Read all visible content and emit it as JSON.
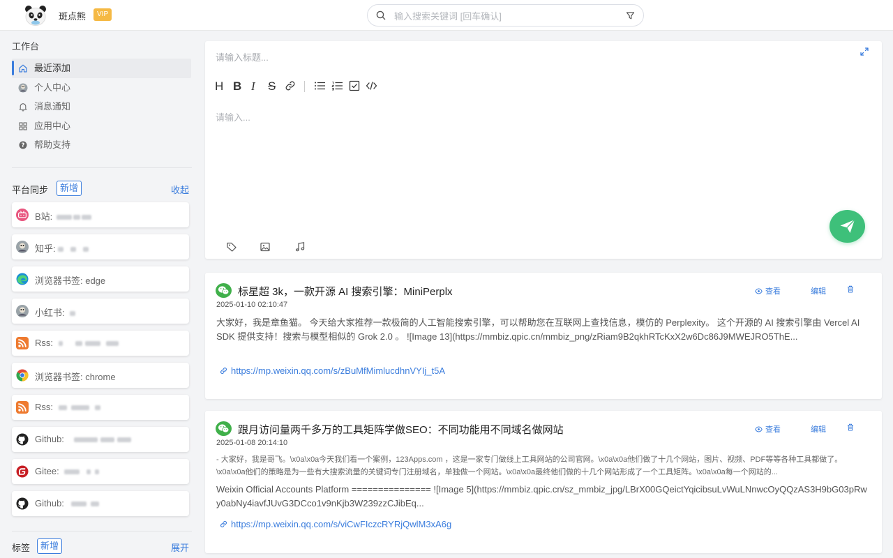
{
  "header": {
    "app_name": "斑点熊",
    "vip_badge": "VIP",
    "search_placeholder": "输入搜索关键词 [回车确认]"
  },
  "sidebar": {
    "workspace_title": "工作台",
    "nav": [
      {
        "label": "最近添加",
        "icon": "home-icon",
        "active": true
      },
      {
        "label": "个人中心",
        "icon": "avatar-icon"
      },
      {
        "label": "消息通知",
        "icon": "bell-icon"
      },
      {
        "label": "应用中心",
        "icon": "grid-icon"
      },
      {
        "label": "帮助支持",
        "icon": "help-icon"
      }
    ],
    "platform_sync": {
      "title": "平台同步",
      "add_label": "新增",
      "toggle_label": "收起"
    },
    "platforms": [
      {
        "label": "B站:",
        "icon": "bilibili-icon",
        "blurred": true
      },
      {
        "label": "知乎:",
        "icon": "avatar-icon",
        "blurred": true
      },
      {
        "label": "浏览器书签: edge",
        "icon": "edge-icon"
      },
      {
        "label": "小红书: ",
        "icon": "avatar-icon",
        "blurred": true
      },
      {
        "label": "Rss: ",
        "icon": "rss-icon",
        "blurred": true
      },
      {
        "label": "浏览器书签: chrome",
        "icon": "chrome-icon"
      },
      {
        "label": "Rss: ",
        "icon": "rss-icon",
        "blurred": true
      },
      {
        "label": "Github: ",
        "icon": "github-icon",
        "blurred": true
      },
      {
        "label": "Gitee: ",
        "icon": "gitee-icon",
        "blurred": true
      },
      {
        "label": "Github: ",
        "icon": "github-icon",
        "blurred": true
      }
    ],
    "tags": {
      "title": "标签",
      "add_label": "新增",
      "toggle_label": "展开"
    }
  },
  "editor": {
    "title_placeholder": "请输入标题...",
    "body_placeholder": "请输入...",
    "toolbar": [
      "heading",
      "bold",
      "italic",
      "strikethrough",
      "link",
      "bullet-list",
      "ordered-list",
      "task-list",
      "code"
    ],
    "heading_glyph": "H",
    "bold_glyph": "B",
    "italic_glyph": "I",
    "strike_glyph": "S"
  },
  "cards": [
    {
      "title": "标星超 3k，一款开源 AI 搜索引擎：MiniPerplx",
      "date": "2025-01-10 02:10:47",
      "excerpt": "大家好，我是章鱼猫。 今天给大家推荐一款极简的人工智能搜索引擎，可以帮助您在互联网上查找信息，模仿的 Perplexity。 这个开源的 AI 搜索引擎由 Vercel AI SDK 提供支持！搜索与模型相似的 Grok 2.0 。 ![Image 13](https://mmbiz.qpic.cn/mmbiz_png/zRiam9B2qkhRTcKxX2w6Dc86J9MWEJRO5ThE...",
      "link": "https://mp.weixin.qq.com/s/zBuMfMimlucdhnVYIj_t5A",
      "actions": {
        "view": "查看",
        "edit": "编辑"
      }
    },
    {
      "title": "跟月访问量两千多万的工具矩阵学做SEO：不同功能用不同域名做网站",
      "date": "2025-01-08 20:14:10",
      "summary": "- 大家好，我是哥飞。\\x0a\\x0a今天我们看一个案例，123Apps.com ，这是一家专门做线上工具网站的公司官网。\\x0a\\x0a他们做了十几个网站，图片、视频、PDF等等各种工具都做了。\\x0a\\x0a他们的策略是为一些有大搜索流量的关键词专门注册域名，单独做一个网站。\\x0a\\x0a最终他们做的十几个网站形成了一个工具矩阵。\\x0a\\x0a每一个网站的...",
      "excerpt": "Weixin Official Accounts Platform =============== ![Image 5](https://mmbiz.qpic.cn/sz_mmbiz_jpg/LBrX00GQeictYqicibsuLvWuLNnwcOyQQzAS3H9bG03pRwy0abNy4iavfJUvG3DCco1v9nKjb3W239zzCJibEq...",
      "link": "https://mp.weixin.qq.com/s/viCwFIczcRYRjQwlM3xA6g",
      "actions": {
        "view": "查看",
        "edit": "编辑"
      }
    }
  ],
  "colors": {
    "accent": "#3b7ddd",
    "send": "#3ec07a",
    "vip": "#f5b944",
    "wechat": "#40b04a"
  }
}
